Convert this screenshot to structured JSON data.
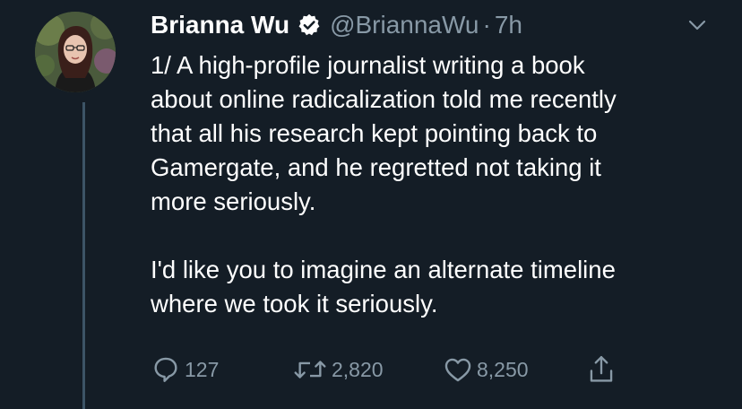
{
  "tweet": {
    "author": {
      "display_name": "Brianna Wu",
      "handle": "@BriannaWu",
      "verified": true
    },
    "separator": "·",
    "time": "7h",
    "text_lines_p1": [
      "1/ A high-profile journalist writing a book",
      "about online radicalization told me recently",
      "that all his research kept pointing back to",
      "Gamergate, and he regretted not taking it",
      "more seriously."
    ],
    "text_lines_p2": [
      "I'd like you to imagine an alternate timeline",
      "where we took it seriously."
    ],
    "actions": {
      "reply_count": "127",
      "retweet_count": "2,820",
      "like_count": "8,250"
    }
  },
  "colors": {
    "background": "#141d26",
    "text_primary": "#ffffff",
    "text_secondary": "#8899a6",
    "thread_line": "#3d5466"
  },
  "icons": {
    "verified": "verified-badge-icon",
    "menu": "chevron-down-icon",
    "reply": "reply-icon",
    "retweet": "retweet-icon",
    "like": "heart-icon",
    "share": "share-icon"
  }
}
